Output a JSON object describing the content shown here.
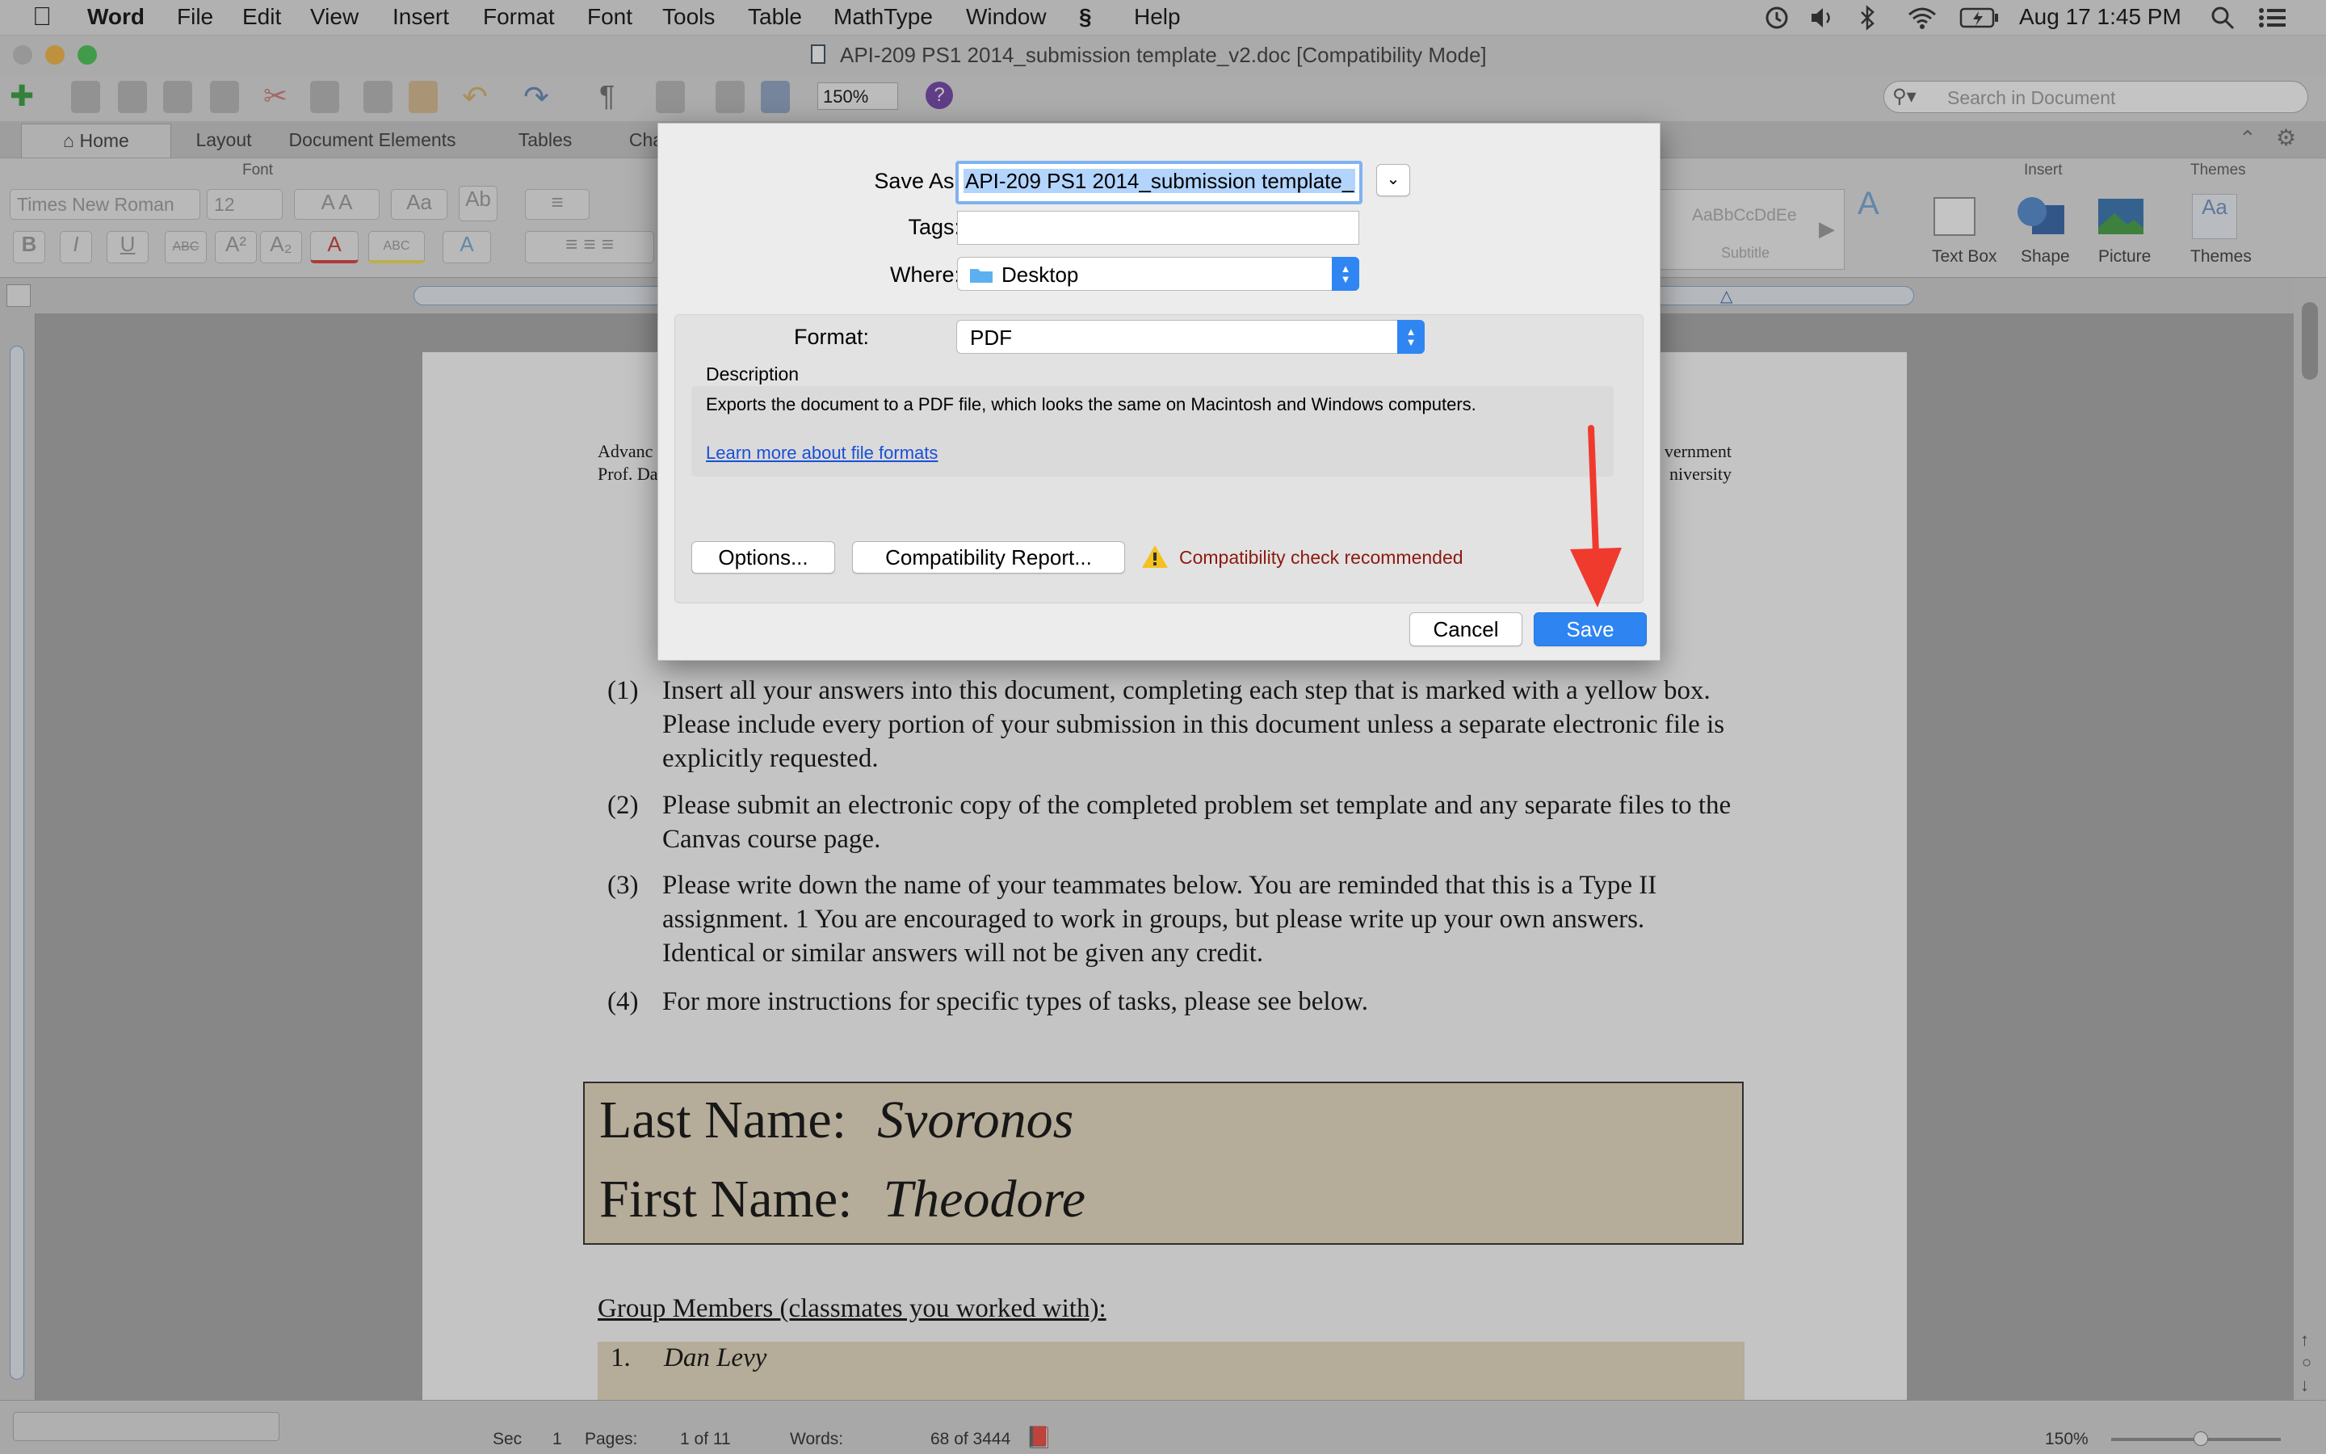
{
  "menubar": {
    "app_name": "Word",
    "items": [
      "File",
      "Edit",
      "View",
      "Insert",
      "Format",
      "Font",
      "Tools",
      "Table",
      "MathType",
      "Window",
      "Help"
    ],
    "clock": "Aug 17  1:45 PM"
  },
  "window": {
    "title": "API-209 PS1 2014_submission template_v2.doc [Compatibility Mode]",
    "zoom": "150%",
    "search_placeholder": "Search in Document"
  },
  "ribbon": {
    "tabs": [
      "Home",
      "Layout",
      "Document Elements",
      "Tables",
      "Cha"
    ],
    "groups": {
      "font": "Font",
      "insert": "Insert",
      "themes": "Themes"
    },
    "font_name": "Times New Roman",
    "font_size": "12",
    "style_preview": "AaBbCcDdEe",
    "style_name": "Subtitle",
    "insert_items": [
      "Text Box",
      "Shape",
      "Picture"
    ],
    "themes_label": "Themes",
    "themes_preview": "Aa"
  },
  "document": {
    "header_left": [
      "Advanc",
      "Prof. Da"
    ],
    "header_right": [
      "vernment",
      "niversity"
    ],
    "instructions": [
      {
        "num": "(1)",
        "text": "Insert all your answers into this document, completing each step that is marked with a yellow box. Please include every portion of your submission in this document unless a separate electronic file is explicitly requested."
      },
      {
        "num": "(2)",
        "text": "Please submit an electronic copy of the completed problem set template and any separate files to the Canvas course page."
      },
      {
        "num": "(3)",
        "text": "Please write down the name of your teammates below. You are reminded that this is a Type II assignment. 1 You are encouraged to work in groups, but please write up your own answers. Identical or similar answers will not be given any credit."
      },
      {
        "num": "(4)",
        "text": "For more instructions for specific types of tasks, please see below."
      }
    ],
    "last_name_label": "Last Name:",
    "last_name": "Svoronos",
    "first_name_label": "First Name:",
    "first_name": "Theodore",
    "group_heading": "Group Members (classmates you worked with):",
    "group_members": [
      {
        "num": "1.",
        "name": "Dan Levy"
      }
    ]
  },
  "save_dialog": {
    "save_as_label": "Save As:",
    "save_as_value": "API-209 PS1 2014_submission template_",
    "tags_label": "Tags:",
    "where_label": "Where:",
    "where_value": "Desktop",
    "format_label": "Format:",
    "format_value": "PDF",
    "description_label": "Description",
    "description_text": "Exports the document to a PDF file, which looks the same on Macintosh and Windows computers.",
    "learn_more_link": "Learn more about file formats",
    "options_button": "Options...",
    "compat_report_button": "Compatibility Report...",
    "compat_warning": "Compatibility check recommended",
    "cancel_button": "Cancel",
    "save_button": "Save"
  },
  "statusbar": {
    "sec_label": "Sec",
    "sec_value": "1",
    "pages_label": "Pages:",
    "pages_value": "1 of 11",
    "words_label": "Words:",
    "words_value": "68 of 3444",
    "zoom": "150%"
  },
  "colors": {
    "accent": "#2e84f1",
    "annotation_arrow": "#f03a2e",
    "warning_text": "#8b1a10",
    "answer_box": "#e9dcc0",
    "link": "#1a4fd6"
  }
}
